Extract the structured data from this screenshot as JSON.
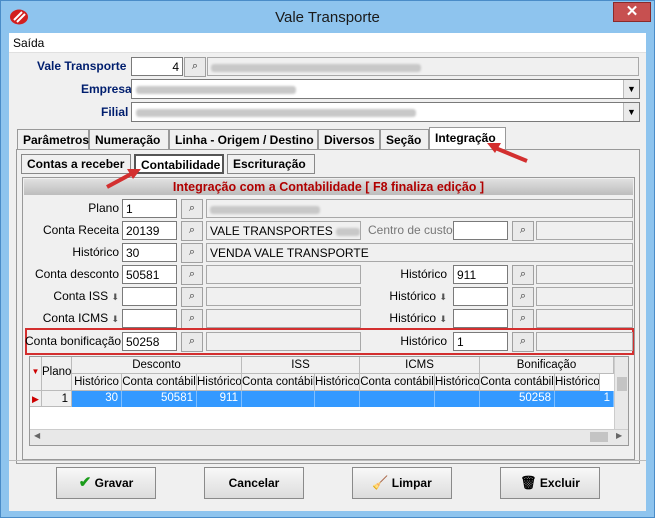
{
  "window": {
    "title": "Vale Transporte",
    "close_glyph": "✕"
  },
  "menu": {
    "saida": "Saída"
  },
  "header": {
    "vale_label": "Vale Transporte",
    "vale_number": "4",
    "empresa_label": "Empresa",
    "filial_label": "Filial"
  },
  "tabs": [
    "Parâmetros",
    "Numeração",
    "Linha - Origem / Destino",
    "Diversos",
    "Seção",
    "Integração"
  ],
  "subtabs": [
    "Contas a receber",
    "Contabilidade",
    "Escrituração"
  ],
  "section_title": "Integração com a Contabilidade [ F8 finaliza edição ]",
  "form": {
    "plano_label": "Plano",
    "plano_value": "1",
    "conta_receita_label": "Conta Receita",
    "conta_receita_value": "20139",
    "conta_receita_desc": "VALE TRANSPORTES",
    "centro_custos_label": "Centro de custos",
    "historico_label": "Histórico",
    "historico_value": "30",
    "historico_desc": "VENDA VALE TRANSPORTE",
    "conta_desconto_label": "Conta desconto",
    "conta_desconto_value": "50581",
    "historico_desconto_value": "911",
    "conta_iss_label": "Conta ISS",
    "conta_icms_label": "Conta ICMS",
    "conta_bonificacao_label": "Conta bonificação",
    "conta_bonificacao_value": "50258",
    "historico_bonificacao_value": "1"
  },
  "grid": {
    "plano_header": "Plano",
    "groups": [
      "Desconto",
      "ISS",
      "ICMS",
      "Bonificação"
    ],
    "sub": {
      "historico": "Histórico",
      "conta": "Conta contábil"
    },
    "row": {
      "plano": "1",
      "d_hist": "30",
      "d_conta": "50581",
      "iss_hist": "911",
      "iss_conta": "",
      "icms_hist": "",
      "icms_conta": "",
      "b_hist": "",
      "b_conta": "50258",
      "last_hist": "1"
    }
  },
  "buttons": {
    "gravar": "Gravar",
    "cancelar": "Cancelar",
    "limpar": "Limpar",
    "excluir": "Excluir"
  },
  "colors": {
    "accent_red": "#b00000",
    "selection_blue": "#3399ff",
    "annotation_red": "#d32f2f"
  }
}
